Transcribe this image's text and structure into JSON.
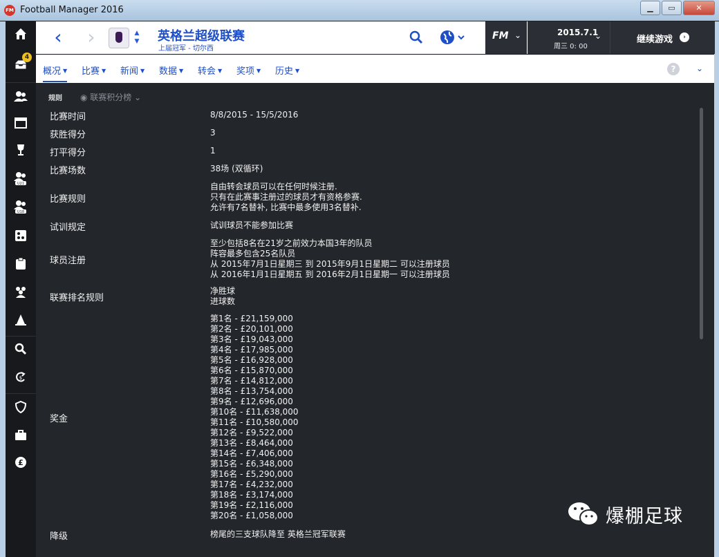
{
  "window": {
    "title": "Football Manager 2016"
  },
  "sidebar": {
    "inbox_badge": "4"
  },
  "header": {
    "competition_title": "英格兰超级联赛",
    "competition_subtitle": "上届冠军 - 切尔西",
    "fm_logo": "FM",
    "date": "2015.7.1",
    "time": "周三 0: 00",
    "continue_label": "继续游戏"
  },
  "tabs": [
    {
      "label": "概况"
    },
    {
      "label": "比赛"
    },
    {
      "label": "新闻"
    },
    {
      "label": "数据"
    },
    {
      "label": "转会"
    },
    {
      "label": "奖项"
    },
    {
      "label": "历史"
    }
  ],
  "subbar": {
    "section_label": "规则",
    "standings_label": "联赛积分榜"
  },
  "rules": [
    {
      "label": "比赛时间",
      "lines": [
        "8/8/2015 - 15/5/2016"
      ]
    },
    {
      "label": "获胜得分",
      "lines": [
        "3"
      ]
    },
    {
      "label": "打平得分",
      "lines": [
        "1"
      ]
    },
    {
      "label": "比赛场数",
      "lines": [
        "38场 (双循环)"
      ]
    },
    {
      "label": "比赛规则",
      "lines": [
        "自由转会球员可以在任何时候注册.",
        "只有在此赛事注册过的球员才有资格参赛.",
        "允许有7名替补, 比赛中最多使用3名替补."
      ]
    },
    {
      "label": "试训规定",
      "lines": [
        "试训球员不能参加比赛"
      ]
    },
    {
      "label": "球员注册",
      "lines": [
        "至少包括8名在21岁之前效力本国3年的队员",
        "阵容最多包含25名队员",
        "从 2015年7月1日星期三 到 2015年9月1日星期二 可以注册球员",
        "从 2016年1月1日星期五 到 2016年2月1日星期一 可以注册球员"
      ]
    },
    {
      "label": "联赛排名规则",
      "lines": [
        "净胜球",
        "进球数"
      ]
    },
    {
      "label": "奖金",
      "lines": [
        "第1名 - £21,159,000",
        "第2名 - £20,101,000",
        "第3名 - £19,043,000",
        "第4名 - £17,985,000",
        "第5名 - £16,928,000",
        "第6名 - £15,870,000",
        "第7名 - £14,812,000",
        "第8名 - £13,754,000",
        "第9名 - £12,696,000",
        "第10名 - £11,638,000",
        "第11名 - £10,580,000",
        "第12名 - £9,522,000",
        "第13名 - £8,464,000",
        "第14名 - £7,406,000",
        "第15名 - £6,348,000",
        "第16名 - £5,290,000",
        "第17名 - £4,232,000",
        "第18名 - £3,174,000",
        "第19名 - £2,116,000",
        "第20名 - £1,058,000"
      ]
    },
    {
      "label": "降级",
      "lines": [
        "榜尾的三支球队降至 英格兰冠军联赛"
      ]
    }
  ],
  "watermark": {
    "text": "爆棚足球"
  }
}
